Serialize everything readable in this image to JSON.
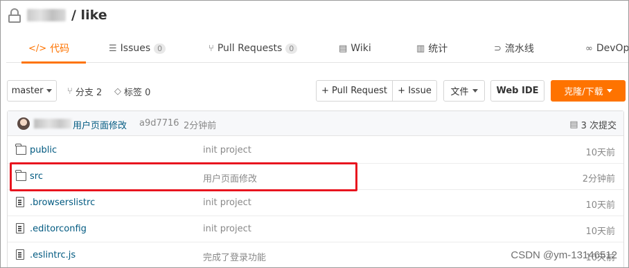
{
  "repo": {
    "owner_redacted": true,
    "separator_name": "/ like"
  },
  "tabs": [
    {
      "icon": "code-icon",
      "glyph": "</>",
      "label": "代码",
      "active": true
    },
    {
      "icon": "issues-icon",
      "glyph": "☰",
      "label": "Issues",
      "count": "0"
    },
    {
      "icon": "pull-request-icon",
      "glyph": "⑂",
      "label": "Pull Requests",
      "count": "0"
    },
    {
      "icon": "wiki-icon",
      "glyph": "▤",
      "label": "Wiki"
    },
    {
      "icon": "stats-icon",
      "glyph": "▥",
      "label": "统计"
    },
    {
      "icon": "pipeline-icon",
      "glyph": "⊃",
      "label": "流水线"
    },
    {
      "icon": "devops-icon",
      "glyph": "∞",
      "label": "DevOps"
    }
  ],
  "toolbar": {
    "branch": "master",
    "branches_label": "分支 2",
    "tags_label": "标签 0",
    "pull_request": "+ Pull Request",
    "issue": "+ Issue",
    "files": "文件",
    "web_ide": "Web IDE",
    "clone": "克隆/下载"
  },
  "commit": {
    "message": "用户页面修改",
    "hash": "a9d7716",
    "time": "2分钟前",
    "commits_label": "3 次提交"
  },
  "files": [
    {
      "type": "folder",
      "name": "public",
      "message": "init project",
      "time": "10天前"
    },
    {
      "type": "folder",
      "name": "src",
      "message": "用户页面修改",
      "time": "2分钟前"
    },
    {
      "type": "file",
      "name": ".browserslistrc",
      "message": "init project",
      "time": "10天前"
    },
    {
      "type": "file",
      "name": ".editorconfig",
      "message": "init project",
      "time": "10天前"
    },
    {
      "type": "file",
      "name": ".eslintrc.js",
      "message": "完成了登录功能",
      "time": "10天前"
    }
  ],
  "watermark": "CSDN @ym-13146512",
  "colors": {
    "accent": "#fe7300",
    "link": "#005980",
    "highlight": "#e8141e"
  }
}
